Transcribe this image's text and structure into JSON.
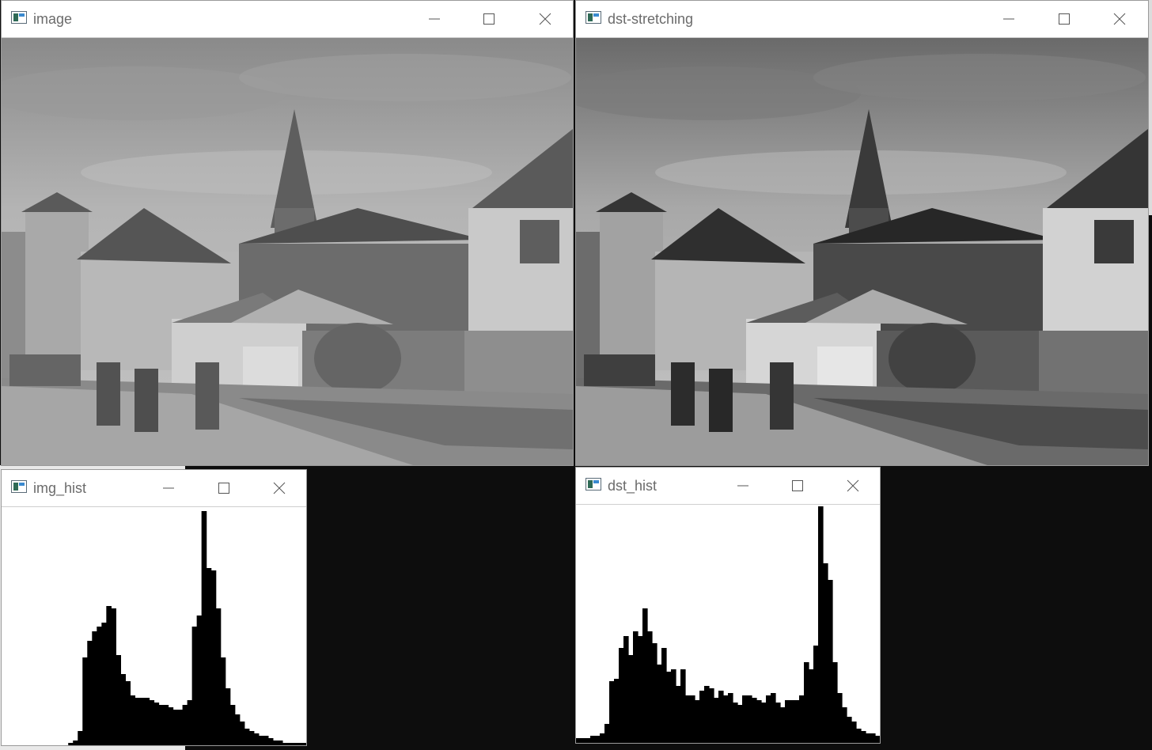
{
  "windows": {
    "image": {
      "title": "image"
    },
    "dst_stretching": {
      "title": "dst-stretching"
    },
    "img_hist": {
      "title": "img_hist"
    },
    "dst_hist": {
      "title": "dst_hist"
    }
  },
  "window_controls": {
    "minimize_icon": "minimize-icon",
    "maximize_icon": "maximize-icon",
    "close_icon": "close-icon",
    "app_icon": "app-window-icon"
  },
  "colors": {
    "desktop": "#0d0d0d",
    "titlebar": "#ffffff",
    "title_text": "#6b6b6b",
    "histogram_bar": "#000000",
    "histogram_background": "#ffffff"
  },
  "chart_data": [
    {
      "type": "bar",
      "name": "img_hist",
      "bins": 64,
      "ylim": [
        0,
        1
      ],
      "values": [
        0,
        0,
        0,
        0,
        0,
        0,
        0,
        0,
        0,
        0,
        0,
        0,
        0,
        0,
        0.01,
        0.02,
        0.06,
        0.37,
        0.44,
        0.48,
        0.5,
        0.52,
        0.59,
        0.58,
        0.38,
        0.3,
        0.27,
        0.21,
        0.2,
        0.2,
        0.2,
        0.19,
        0.18,
        0.17,
        0.17,
        0.16,
        0.15,
        0.15,
        0.17,
        0.19,
        0.5,
        0.55,
        0.99,
        0.75,
        0.74,
        0.58,
        0.37,
        0.24,
        0.17,
        0.13,
        0.1,
        0.07,
        0.06,
        0.05,
        0.04,
        0.04,
        0.03,
        0.02,
        0.02,
        0.01,
        0.01,
        0.01,
        0.01,
        0.01
      ]
    },
    {
      "type": "bar",
      "name": "dst_hist",
      "bins": 64,
      "ylim": [
        0,
        1
      ],
      "values": [
        0.02,
        0.02,
        0.02,
        0.03,
        0.03,
        0.04,
        0.08,
        0.26,
        0.27,
        0.4,
        0.45,
        0.37,
        0.47,
        0.45,
        0.57,
        0.47,
        0.42,
        0.33,
        0.4,
        0.3,
        0.31,
        0.24,
        0.31,
        0.2,
        0.2,
        0.18,
        0.22,
        0.24,
        0.23,
        0.19,
        0.22,
        0.2,
        0.21,
        0.17,
        0.16,
        0.2,
        0.2,
        0.19,
        0.18,
        0.17,
        0.2,
        0.21,
        0.17,
        0.15,
        0.18,
        0.18,
        0.18,
        0.2,
        0.34,
        0.31,
        0.41,
        1.0,
        0.76,
        0.69,
        0.34,
        0.21,
        0.15,
        0.11,
        0.09,
        0.06,
        0.05,
        0.04,
        0.04,
        0.03
      ]
    }
  ]
}
